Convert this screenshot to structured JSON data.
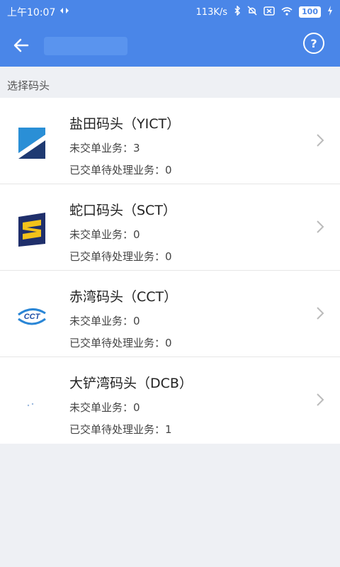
{
  "status": {
    "time": "上午10:07",
    "speed": "113K/s",
    "battery": "100"
  },
  "section_label": "选择码头",
  "items": [
    {
      "name": "盐田码头（YICT）",
      "pending_label": "未交单业务：",
      "pending": "3",
      "processing_label": "已交单待处理业务：",
      "processing": "0"
    },
    {
      "name": "蛇口码头（SCT）",
      "pending_label": "未交单业务：",
      "pending": "0",
      "processing_label": "已交单待处理业务：",
      "processing": "0"
    },
    {
      "name": "赤湾码头（CCT）",
      "pending_label": "未交单业务：",
      "pending": "0",
      "processing_label": "已交单待处理业务：",
      "processing": "0"
    },
    {
      "name": "大铲湾码头（DCB）",
      "pending_label": "未交单业务：",
      "pending": "0",
      "processing_label": "已交单待处理业务：",
      "processing": "1"
    }
  ],
  "logos": {
    "cct_text": "CCT"
  }
}
